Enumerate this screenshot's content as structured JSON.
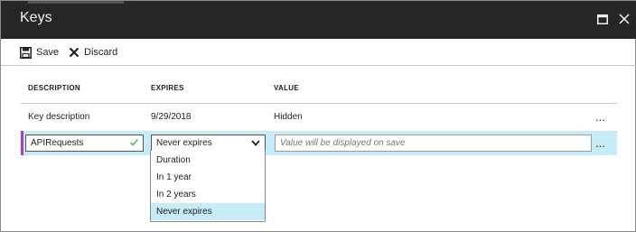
{
  "window": {
    "title": "Keys",
    "maximize_icon": "maximize-icon",
    "close_icon": "close-icon"
  },
  "toolbar": {
    "save_label": "Save",
    "save_icon": "floppy-disk-icon",
    "discard_label": "Discard",
    "discard_icon": "x-icon"
  },
  "table": {
    "headers": [
      "DESCRIPTION",
      "EXPIRES",
      "VALUE"
    ],
    "rows": [
      {
        "description": "Key description",
        "expires": "9/29/2018",
        "value": "Hidden"
      }
    ],
    "new_row": {
      "description_value": "APIRequests",
      "expires_selected": "Never expires",
      "value_placeholder": "Value will be displayed on save"
    },
    "more_label": "..."
  },
  "expires_dropdown": {
    "options": [
      "Duration",
      "In 1 year",
      "In 2 years",
      "Never expires"
    ],
    "selected": "Never expires"
  },
  "colors": {
    "titlebar": "#262626",
    "selected_row": "#c6ecf7",
    "selection_bar": "#b23bcb",
    "valid_check": "#5cb85c"
  }
}
